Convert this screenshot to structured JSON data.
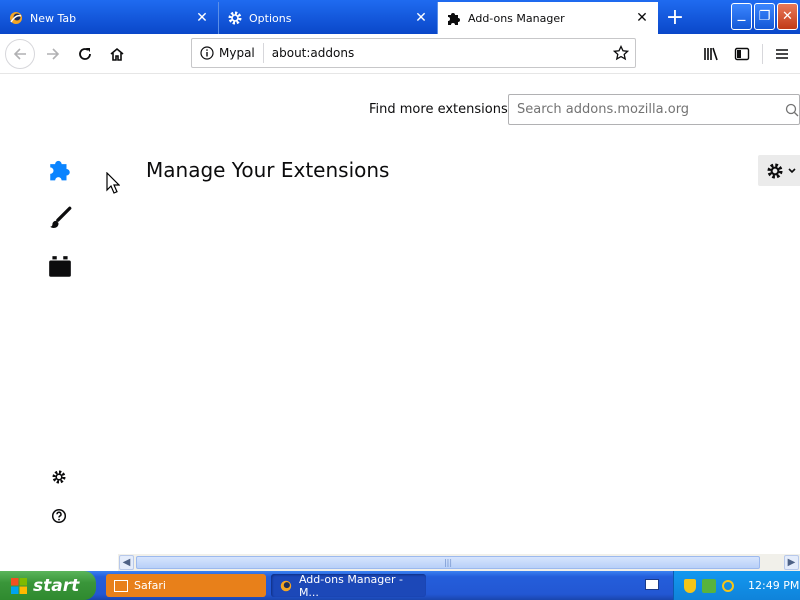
{
  "tabs": [
    {
      "label": "New Tab",
      "icon": "firefox-icon",
      "selected": false
    },
    {
      "label": "Options",
      "icon": "gear-icon",
      "selected": false
    },
    {
      "label": "Add-ons Manager",
      "icon": "puzzle-icon",
      "selected": true
    }
  ],
  "newtab_label": "+",
  "window_controls": {
    "minimize": "—",
    "restore": "❐",
    "close": "✕"
  },
  "navbar": {
    "identity_label": "Mypal",
    "url": "about:addons"
  },
  "addons": {
    "find_more_label": "Find more extensions",
    "search_placeholder": "Search addons.mozilla.org",
    "heading": "Manage Your Extensions",
    "categories": [
      {
        "name": "extensions",
        "icon": "puzzle-icon",
        "selected": true
      },
      {
        "name": "themes",
        "icon": "brush-icon",
        "selected": false
      },
      {
        "name": "plugins",
        "icon": "plugin-block-icon",
        "selected": false
      }
    ],
    "footer": [
      {
        "name": "addon-options",
        "icon": "gear-icon"
      },
      {
        "name": "addon-support",
        "icon": "help-icon"
      }
    ]
  },
  "taskbar": {
    "start_label": "start",
    "items": [
      {
        "label": "Safari",
        "active": false
      },
      {
        "label": "Add-ons Manager - M...",
        "active": true
      }
    ],
    "clock": "12:49 PM"
  },
  "colors": {
    "titlebar": "#0a4fd6",
    "accent": "#0a84ff",
    "taskbar": "#245edb",
    "start": "#3a963a",
    "safari_task": "#e8801a"
  }
}
